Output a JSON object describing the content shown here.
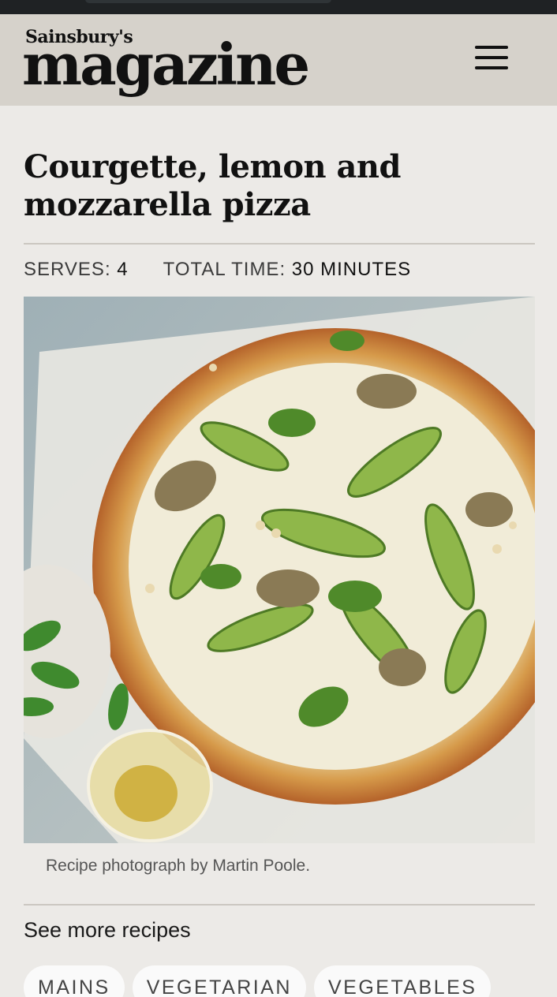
{
  "header": {
    "logo_top": "Sainsbury's",
    "logo_main": "magazine"
  },
  "recipe": {
    "title_line1": "Courgette, lemon and",
    "title_line2": "mozzarella pizza",
    "serves_label": "SERVES:",
    "serves_value": "4",
    "time_label": "TOTAL TIME:",
    "time_value": "30 MINUTES",
    "photo_caption": "Recipe photograph by Martin Poole."
  },
  "more": {
    "heading": "See more recipes",
    "tags": [
      "MAINS",
      "VEGETARIAN",
      "VEGETABLES"
    ]
  },
  "colors": {
    "background": "#eceae7",
    "header_bg": "#d6d2cb",
    "text": "#111111"
  }
}
